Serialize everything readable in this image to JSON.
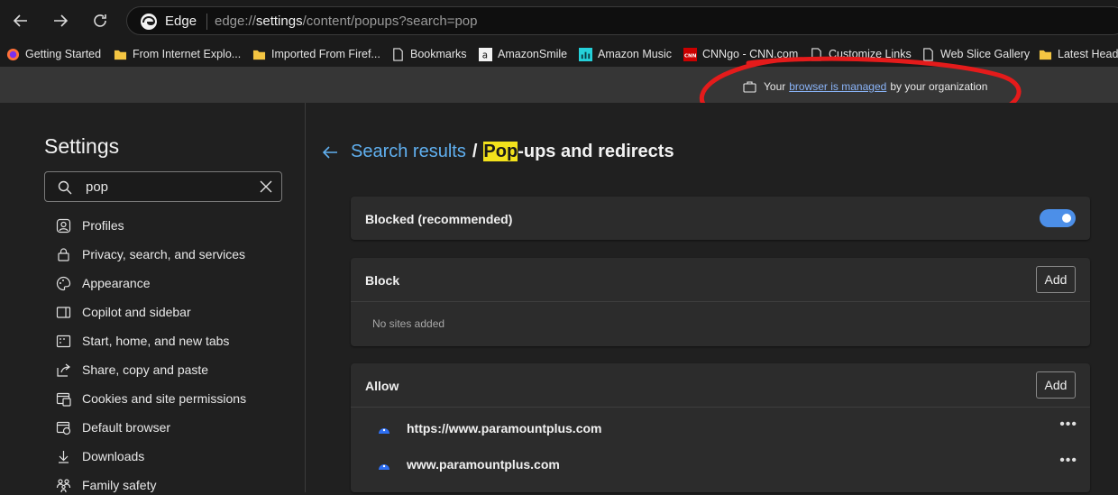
{
  "browser": {
    "name": "Edge",
    "url_prefix": "edge://",
    "url_host": "settings",
    "url_path": "/content/popups?search=pop"
  },
  "bookmarks": [
    {
      "label": "Getting Started",
      "icon": "firefox-icon"
    },
    {
      "label": "From Internet Explo...",
      "icon": "folder-icon"
    },
    {
      "label": "Imported From Firef...",
      "icon": "folder-icon"
    },
    {
      "label": "Bookmarks",
      "icon": "page-icon"
    },
    {
      "label": "AmazonSmile",
      "icon": "amazon-icon"
    },
    {
      "label": "Amazon Music",
      "icon": "amazon-music-icon"
    },
    {
      "label": "CNNgo - CNN.com",
      "icon": "cnn-icon"
    },
    {
      "label": "Customize Links",
      "icon": "page-icon"
    },
    {
      "label": "Web Slice Gallery",
      "icon": "page-icon"
    },
    {
      "label": "Latest Headl",
      "icon": "folder-icon"
    }
  ],
  "managed": {
    "pre": "Your",
    "link": "browser is managed",
    "post": "by your organization"
  },
  "sidebar": {
    "title": "Settings",
    "search_value": "pop",
    "items": [
      {
        "label": "Profiles",
        "icon": "profile-icon"
      },
      {
        "label": "Privacy, search, and services",
        "icon": "lock-icon"
      },
      {
        "label": "Appearance",
        "icon": "palette-icon"
      },
      {
        "label": "Copilot and sidebar",
        "icon": "sidebar-icon"
      },
      {
        "label": "Start, home, and new tabs",
        "icon": "home-tabs-icon"
      },
      {
        "label": "Share, copy and paste",
        "icon": "share-icon"
      },
      {
        "label": "Cookies and site permissions",
        "icon": "cookies-icon"
      },
      {
        "label": "Default browser",
        "icon": "browser-icon"
      },
      {
        "label": "Downloads",
        "icon": "download-icon"
      },
      {
        "label": "Family safety",
        "icon": "family-icon"
      }
    ]
  },
  "breadcrumb": {
    "parent": "Search results",
    "separator": "/",
    "highlight": "Pop",
    "rest": "-ups and redirects"
  },
  "blocked_card": {
    "label": "Blocked (recommended)",
    "toggle_on": true
  },
  "block_card": {
    "title": "Block",
    "add_label": "Add",
    "empty_text": "No sites added"
  },
  "allow_card": {
    "title": "Allow",
    "add_label": "Add",
    "sites": [
      {
        "url": "https://www.paramountplus.com"
      },
      {
        "url": "www.paramountplus.com"
      }
    ]
  },
  "colors": {
    "accent": "#4c8fe8",
    "link": "#60b0f0",
    "highlight": "#f3e21c",
    "annotation": "#e41b1b"
  }
}
